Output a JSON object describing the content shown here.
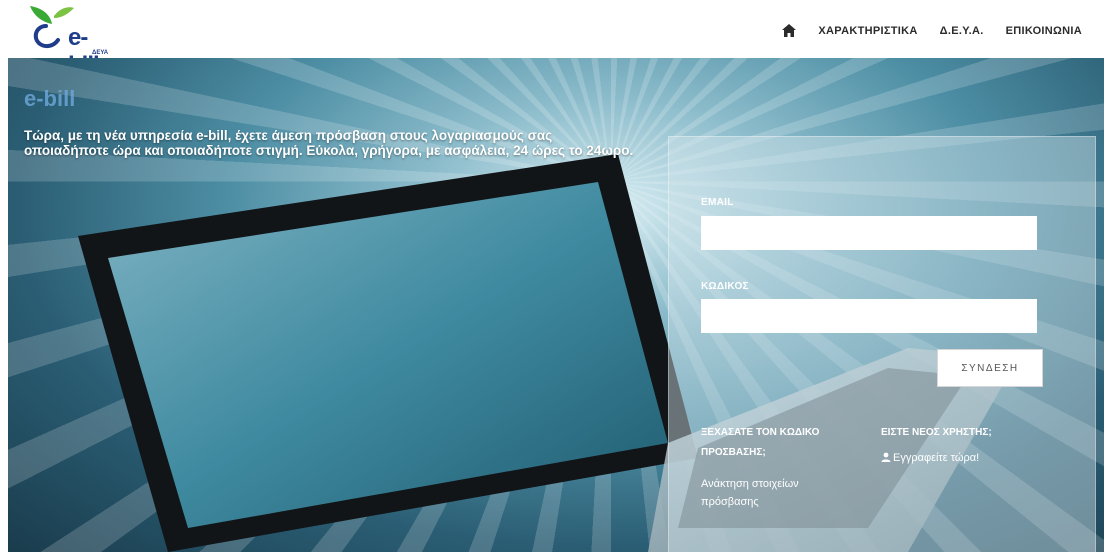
{
  "header": {
    "logo": {
      "text": "e-bill",
      "sub": "ΔΕΥΑ"
    },
    "nav": {
      "home_icon": "home-icon",
      "items": [
        "ΧΑΡΑΚΤΗΡΙΣΤΙΚΑ",
        "Δ.Ε.Υ.Α.",
        "ΕΠΙΚΟΙΝΩΝΙΑ"
      ]
    }
  },
  "hero": {
    "title": "e-bill",
    "text": "Τώρα, με τη νέα υπηρεσία e-bill, έχετε άμεση πρόσβαση στους λογαριασμούς σας οποιαδήποτε ώρα και οποιαδήποτε στιγμή. Εύκολα, γρήγορα, με ασφάλεια, 24 ώρες το 24ωρο."
  },
  "login": {
    "email_label": "EMAIL",
    "email_value": "",
    "password_label": "ΚΩΔΙΚΟΣ",
    "password_value": "",
    "submit_label": "ΣΥΝΔΕΣΗ",
    "forgot_heading": "ΞΕΧΑΣΑΤΕ ΤΟΝ ΚΩΔΙΚΟ ΠΡΟΣΒΑΣΗΣ;",
    "forgot_link": "Ανάκτηση στοιχείων πρόσβασης",
    "new_user_heading": "ΕΙΣΤΕ ΝΕΟΣ ΧΡΗΣΤΗΣ;",
    "register_icon": "user-icon",
    "register_link": "Εγγραφείτε τώρα!"
  },
  "colors": {
    "logo_blue": "#1f3d8a",
    "logo_green": "#3aa935",
    "hero_title": "#6fa8dc"
  }
}
